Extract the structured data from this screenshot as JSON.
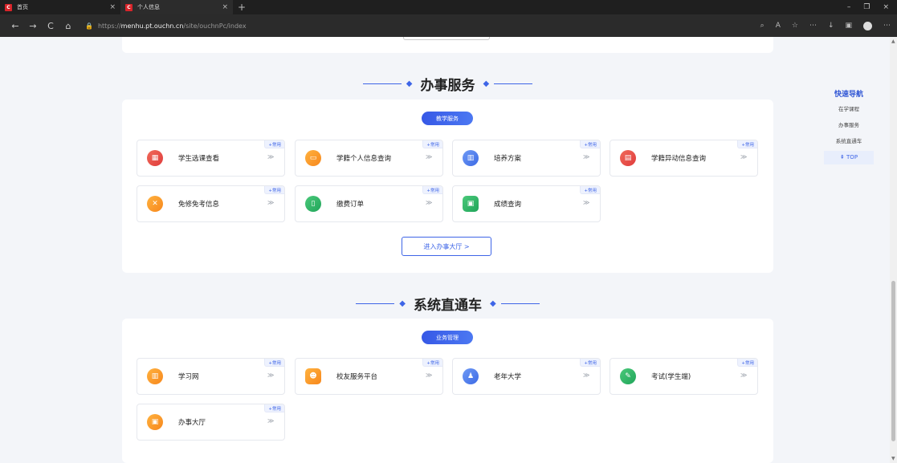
{
  "browser": {
    "tabs": [
      {
        "title": "首页",
        "close": "×"
      },
      {
        "title": "个人信息",
        "close": "×"
      }
    ],
    "new_tab": "+",
    "window_controls": [
      "–",
      "❐",
      "×"
    ],
    "nav": {
      "back": "←",
      "forward": "→",
      "reload": "C",
      "home": "⌂"
    },
    "url_scheme": "https://",
    "url_host": "menhu.pt.ouchn.cn",
    "url_path": "/site/ouchnPc/index",
    "right_tools": [
      "⌕",
      "A",
      "☆",
      "⋯",
      "↓",
      "▣",
      "⋯"
    ]
  },
  "section1": {
    "title": "办事服务",
    "pill": "教学服务",
    "items": [
      {
        "label": "学生选课查看",
        "tag": "+常用",
        "arrow": "≫",
        "icon": "calendar-icon",
        "color": "#e8473f"
      },
      {
        "label": "学籍个人信息查询",
        "tag": "+常用",
        "arrow": "≫",
        "icon": "id-card-icon",
        "color": "#f7931f"
      },
      {
        "label": "培养方案",
        "tag": "+常用",
        "arrow": "≫",
        "icon": "books-icon",
        "color": "#4a76ee"
      },
      {
        "label": "学籍异动信息查询",
        "tag": "+常用",
        "arrow": "≫",
        "icon": "document-icon",
        "color": "#e8473f"
      },
      {
        "label": "免修免考信息",
        "tag": "+常用",
        "arrow": "≫",
        "icon": "cross-icon",
        "color": "#f7931f"
      },
      {
        "label": "缴费订单",
        "tag": "+常用",
        "arrow": "≫",
        "icon": "file-icon",
        "color": "#28b061"
      },
      {
        "label": "成绩查询",
        "tag": "+常用",
        "arrow": "≫",
        "icon": "score-icon",
        "color": "#28b061"
      }
    ],
    "enter_button": "进入办事大厅 >"
  },
  "section2": {
    "title": "系统直通车",
    "pill": "业务管理",
    "items": [
      {
        "label": "学习网",
        "tag": "+常用",
        "arrow": "≫",
        "icon": "book-icon",
        "color": "#f7931f"
      },
      {
        "label": "校友服务平台",
        "tag": "+常用",
        "arrow": "≫",
        "icon": "people-icon",
        "color": "#f7931f"
      },
      {
        "label": "老年大学",
        "tag": "+常用",
        "arrow": "≫",
        "icon": "person-icon",
        "color": "#4a76ee"
      },
      {
        "label": "考试(学生端)",
        "tag": "+常用",
        "arrow": "≫",
        "icon": "exam-icon",
        "color": "#28b061"
      },
      {
        "label": "办事大厅",
        "tag": "+常用",
        "arrow": "≫",
        "icon": "hall-icon",
        "color": "#f7931f"
      }
    ]
  },
  "quick_nav": {
    "title": "快速导航",
    "items": [
      "在学课程",
      "办事服务",
      "系统直通车"
    ],
    "top": "⇞ TOP"
  }
}
